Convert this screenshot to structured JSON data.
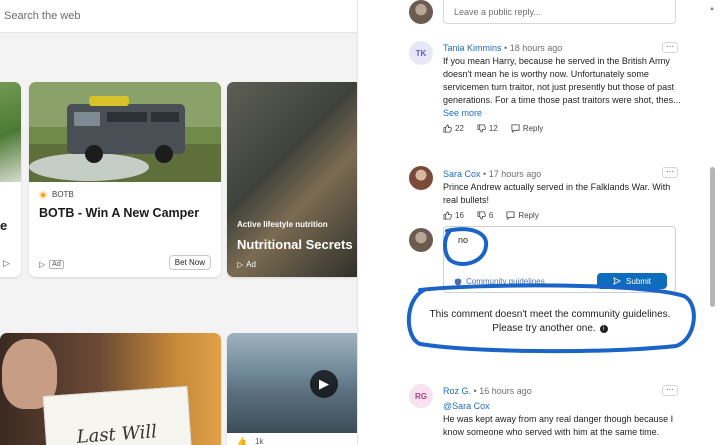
{
  "search": {
    "placeholder": "Search the web"
  },
  "feed": {
    "left_card": {
      "tail_text": "e"
    },
    "camper_card": {
      "source": "BOTB",
      "title": "BOTB - Win A New Camper",
      "ad_label": "Ad",
      "cta": "Bet Now"
    },
    "nutrition_card": {
      "label": "Active lifestyle nutrition",
      "title": "Nutritional Secrets",
      "ad_label": "Ad"
    },
    "oldman_card": {
      "paper_text": "Last Will"
    },
    "ship_card": {
      "foot_count": "1k"
    }
  },
  "comments": {
    "reply_placeholder": "Leave a public reply...",
    "items": [
      {
        "initials": "TK",
        "avatar_color": "#e8e7f7",
        "initials_color": "#5b5fc7",
        "author": "Tania Kimmins",
        "time": "18 hours ago",
        "body": "If you mean Harry, because he served in the British Army doesn't mean he is worthy now. Unfortunately some servicemen turn traitor, not just presently but those of past generations.  For a time those past traitors were shot, thes...",
        "see_more": "See more",
        "likes": "22",
        "dislikes": "12",
        "reply": "Reply"
      },
      {
        "author": "Sara Cox",
        "time": "17 hours ago",
        "body": "Prince Andrew actually served in the Falklands War.  With real bullets!",
        "likes": "16",
        "dislikes": "6",
        "reply": "Reply"
      },
      {
        "initials": "RG",
        "avatar_color": "#f6e3ef",
        "initials_color": "#b23c8a",
        "author": "Roz G.",
        "time": "16 hours ago",
        "mention": "@Sara Cox",
        "body": "He was kept away from any real danger though because I know someone who served with him at the same time."
      }
    ],
    "compose": {
      "text": "no",
      "guidelines": "Community guidelines",
      "submit": "Submit"
    },
    "warning": {
      "line1": "This comment doesn't meet the community guidelines.",
      "line2": "Please try another one."
    },
    "more_label": "···"
  },
  "colors": {
    "link": "#1f6dbd",
    "submit": "#0f6cbd",
    "annotation": "#1a64c8"
  }
}
